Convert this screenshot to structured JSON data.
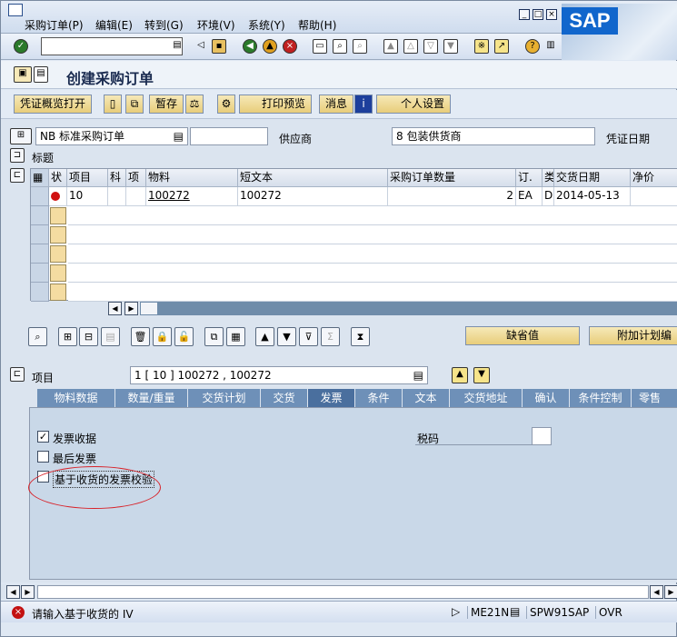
{
  "menu": {
    "items": [
      "采购订单(P)",
      "编辑(E)",
      "转到(G)",
      "环境(V)",
      "系统(Y)",
      "帮助(H)"
    ],
    "logo": "SAP"
  },
  "toolbar": {
    "command_value": ""
  },
  "title": {
    "text": "创建采购订单"
  },
  "appbar": {
    "doc_overview": "凭证概览打开",
    "hold": "暂存",
    "print_preview": "打印预览",
    "messages": "消息",
    "personal_settings": "个人设置"
  },
  "header": {
    "doc_type": "NB 标准采购订单",
    "doc_type_extra": "",
    "vendor_label": "供应商",
    "vendor_value": "8 包装供货商",
    "doc_date_label": "凭证日期",
    "section_label": "标题"
  },
  "grid": {
    "columns": [
      "状",
      "项目",
      "科",
      "项",
      "物料",
      "短文本",
      "采购订单数量",
      "订.",
      "类",
      "交货日期",
      "净价"
    ],
    "rows": [
      {
        "item": "10",
        "material": "100272",
        "short_text": "100272",
        "qty": "2",
        "unit": "EA",
        "cat": "D",
        "date": "2014-05-13"
      }
    ]
  },
  "buttons": {
    "defaults": "缺省值",
    "additional_planning": "附加计划编"
  },
  "item_section": {
    "label": "项目",
    "selected": "1 [ 10 ] 100272 , 100272"
  },
  "tabs": [
    "物料数据",
    "数量/重量",
    "交货计划",
    "交货",
    "发票",
    "条件",
    "文本",
    "交货地址",
    "确认",
    "条件控制",
    "零售"
  ],
  "invoice_tab": {
    "gr_invoice_label": "发票收据",
    "final_invoice_label": "最后发票",
    "gr_based_iv_label": "基于收货的发票校验",
    "tax_code_label": "税码",
    "tax_code_value": "",
    "gr_invoice_checked": true,
    "final_invoice_checked": false,
    "gr_based_iv_checked": false
  },
  "statusbar": {
    "message": "请输入基于收货的 IV",
    "tcode": "ME21N",
    "system": "SPW91SAP",
    "mode": "OVR"
  }
}
